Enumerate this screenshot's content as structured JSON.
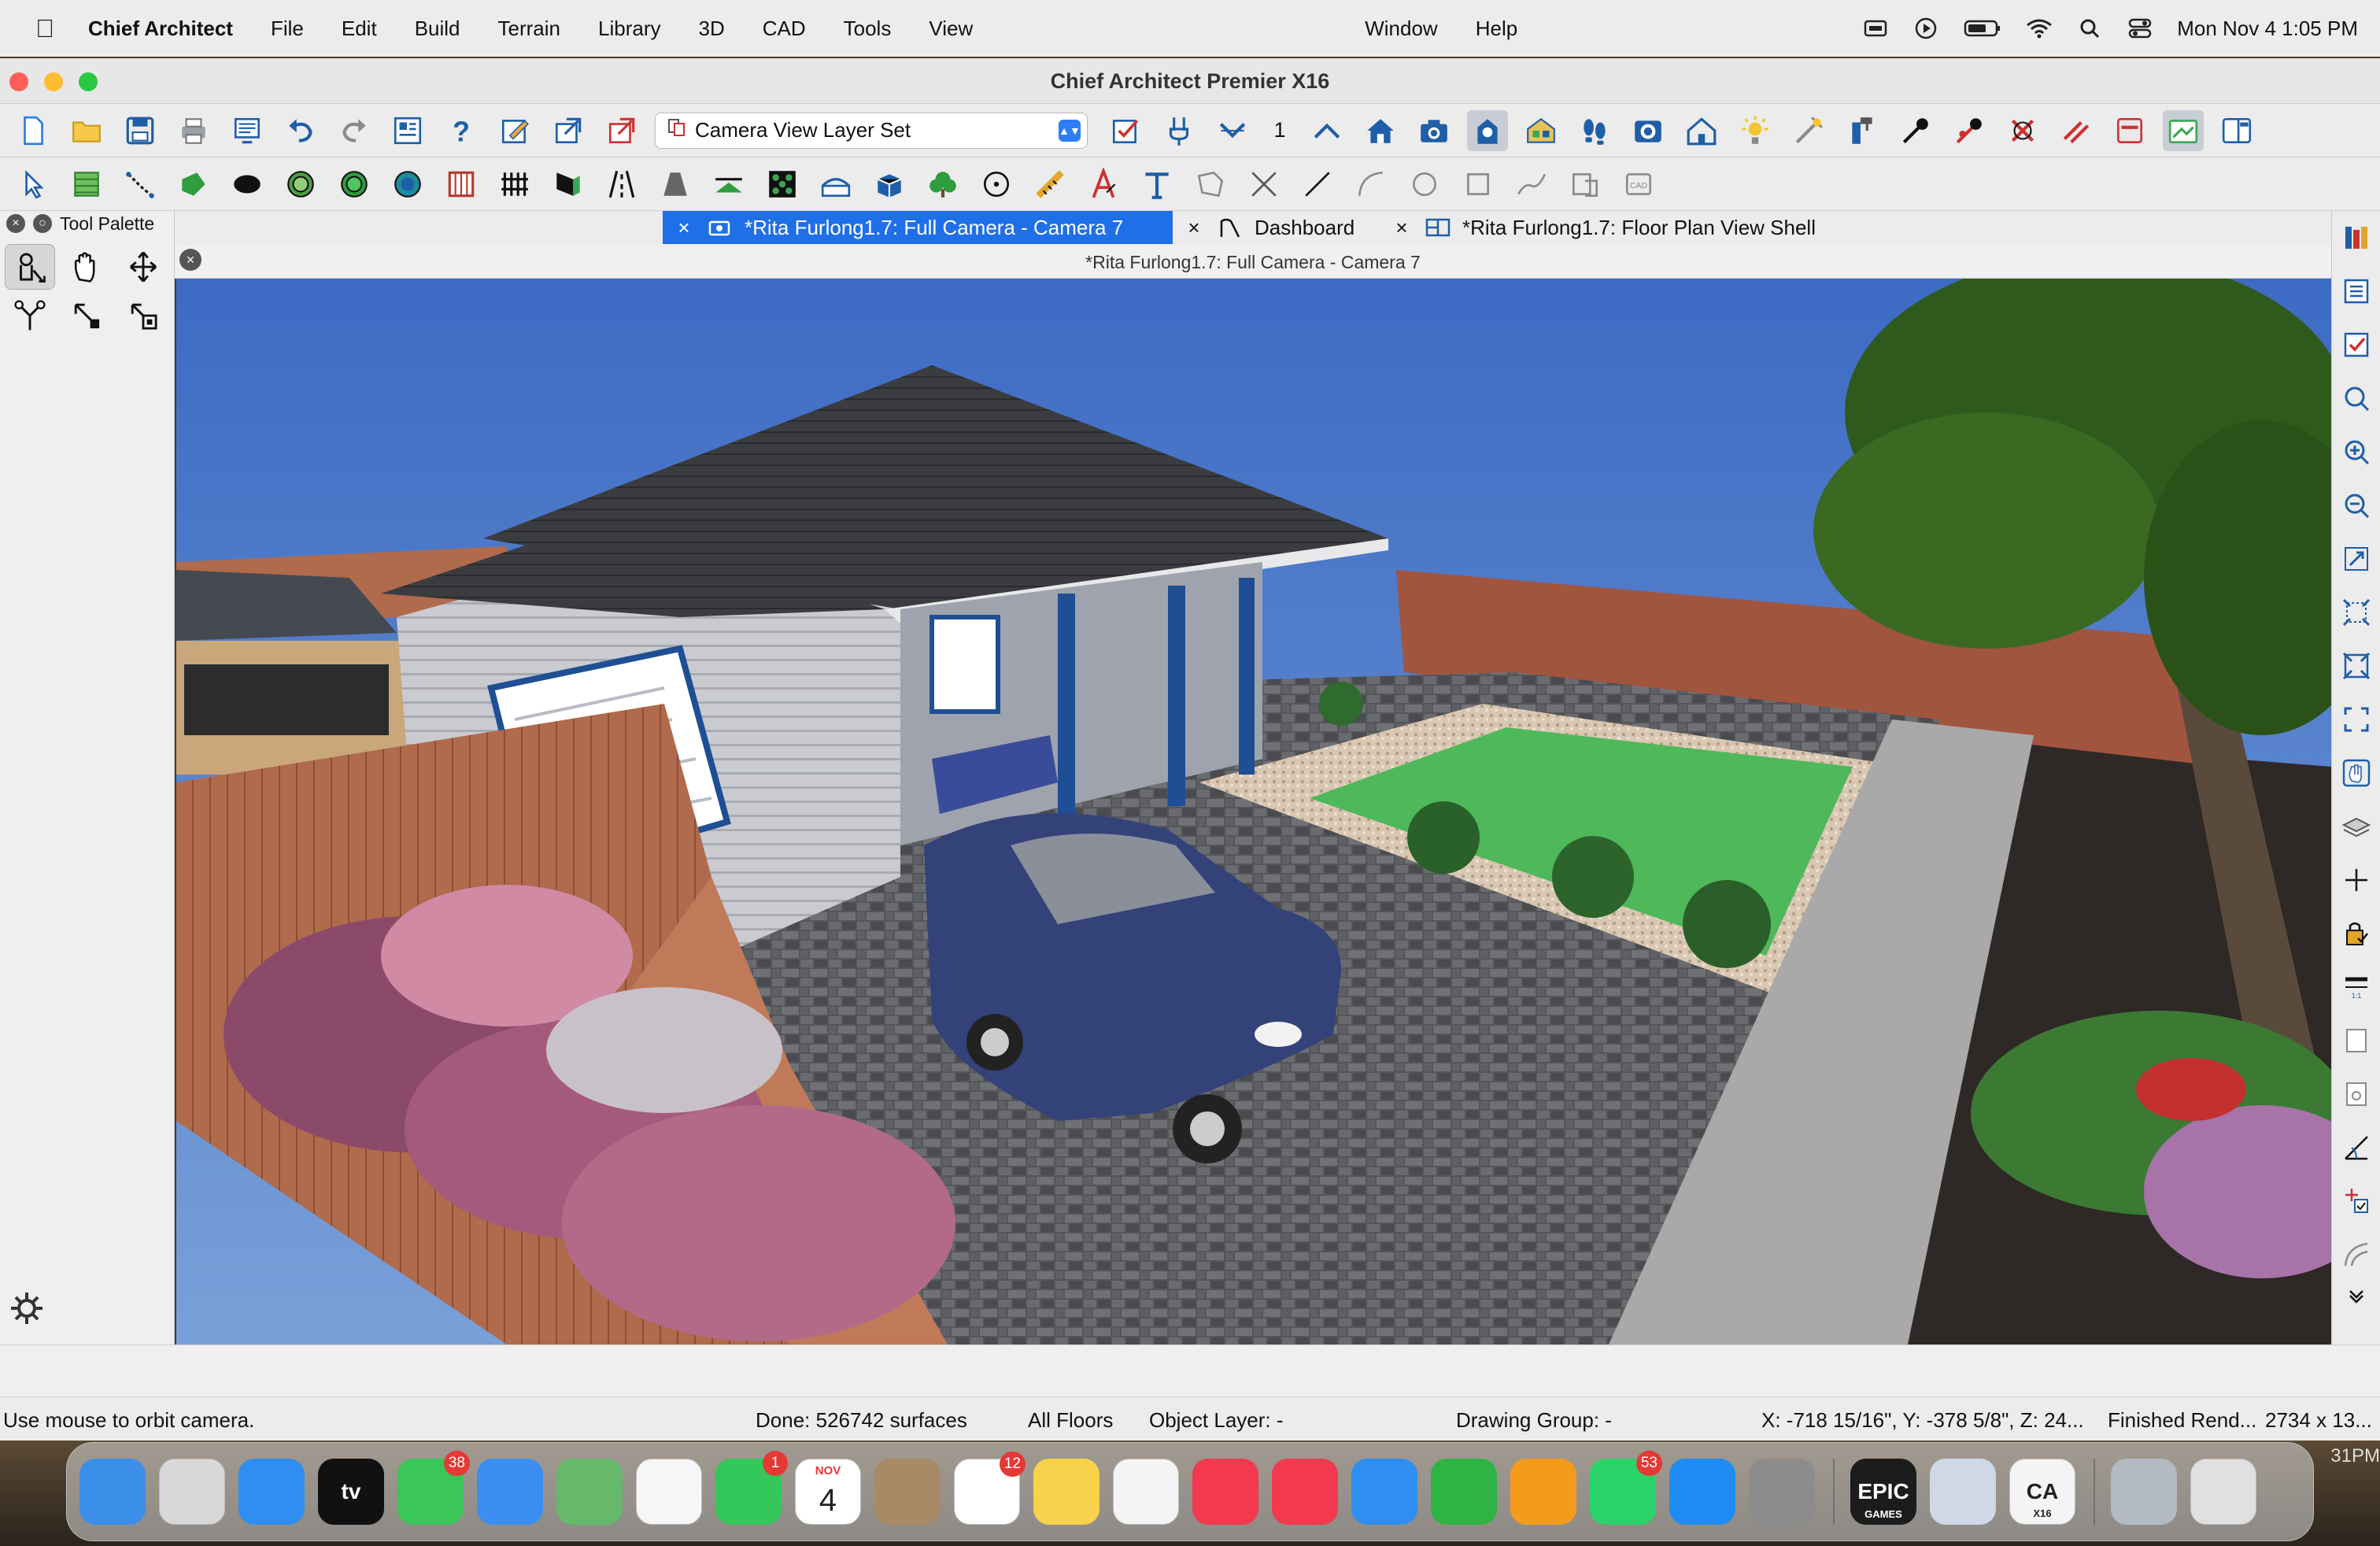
{
  "menubar": {
    "app_name": "Chief Architect",
    "items": [
      "File",
      "Edit",
      "Build",
      "Terrain",
      "Library",
      "3D",
      "CAD",
      "Tools",
      "View"
    ],
    "right_items": [
      "Window",
      "Help"
    ],
    "datetime": "Mon Nov 4  1:05 PM"
  },
  "window": {
    "title": "Chief Architect Premier X16"
  },
  "toolbar": {
    "layer_set": "Camera View Layer Set",
    "floor_number": "1"
  },
  "palette": {
    "title": "Tool Palette"
  },
  "tabs": [
    {
      "label": "*Rita Furlong1.7: Full Camera - Camera 7",
      "active": true
    },
    {
      "label": "Dashboard",
      "active": false
    },
    {
      "label": "*Rita Furlong1.7: Floor Plan View Shell",
      "active": false
    }
  ],
  "view": {
    "title": "*Rita Furlong1.7: Full Camera - Camera 7"
  },
  "status": {
    "hint": "Use mouse to orbit camera.",
    "done": "Done:  526742 surfaces",
    "floors": "All Floors",
    "object_layer": "Object Layer: -",
    "drawing_group": "Drawing Group: -",
    "coords": "X: -718 15/16\", Y: -378 5/8\", Z: 24...",
    "render": "Finished Rend...",
    "size": "2734 x 13..."
  },
  "dock": {
    "apps": [
      {
        "name": "finder",
        "label": "",
        "color": "#3b8fe8"
      },
      {
        "name": "launchpad",
        "label": "",
        "color": "#d8d8d8"
      },
      {
        "name": "safari",
        "label": "",
        "color": "#2f8ff0"
      },
      {
        "name": "apple-tv",
        "label": "tv",
        "color": "#111111"
      },
      {
        "name": "messages",
        "label": "",
        "color": "#3ac659",
        "badge": "38"
      },
      {
        "name": "mail",
        "label": "",
        "color": "#3c8ef0"
      },
      {
        "name": "maps",
        "label": "",
        "color": "#66b86a"
      },
      {
        "name": "photos",
        "label": "",
        "color": "#f6f6f6"
      },
      {
        "name": "facetime",
        "label": "",
        "color": "#34c759",
        "badge": "1"
      },
      {
        "name": "calendar",
        "label": "4",
        "month": "NOV",
        "color": "#ffffff"
      },
      {
        "name": "contacts",
        "label": "",
        "color": "#a88a66"
      },
      {
        "name": "reminders",
        "label": "",
        "color": "#ffffff",
        "badge": "12"
      },
      {
        "name": "notes",
        "label": "",
        "color": "#f7d24a"
      },
      {
        "name": "freeform",
        "label": "",
        "color": "#f4f4f4"
      },
      {
        "name": "music",
        "label": "",
        "color": "#f2394f"
      },
      {
        "name": "news",
        "label": "",
        "color": "#f2394f"
      },
      {
        "name": "keynote",
        "label": "",
        "color": "#2f8ff0"
      },
      {
        "name": "numbers",
        "label": "",
        "color": "#2fb344"
      },
      {
        "name": "pages",
        "label": "",
        "color": "#f59b1c"
      },
      {
        "name": "whatsapp",
        "label": "",
        "color": "#2bd46a",
        "badge": "53"
      },
      {
        "name": "app-store",
        "label": "",
        "color": "#1f8cf3"
      },
      {
        "name": "system-settings",
        "label": "",
        "color": "#8c8c8c"
      }
    ],
    "apps2": [
      {
        "name": "epic-games",
        "label": "EPIC",
        "sublabel": "GAMES",
        "color": "#1c1c1c"
      },
      {
        "name": "preview",
        "label": "",
        "color": "#cfd8e6"
      },
      {
        "name": "chief-architect",
        "label": "CA",
        "sublabel": "X16",
        "color": "#f4f4f4"
      }
    ],
    "apps3": [
      {
        "name": "downloads",
        "label": "",
        "color": "#b4bac2"
      },
      {
        "name": "trash",
        "label": "",
        "color": "#e0e0e0"
      }
    ],
    "clock_fragment": "31PM"
  }
}
